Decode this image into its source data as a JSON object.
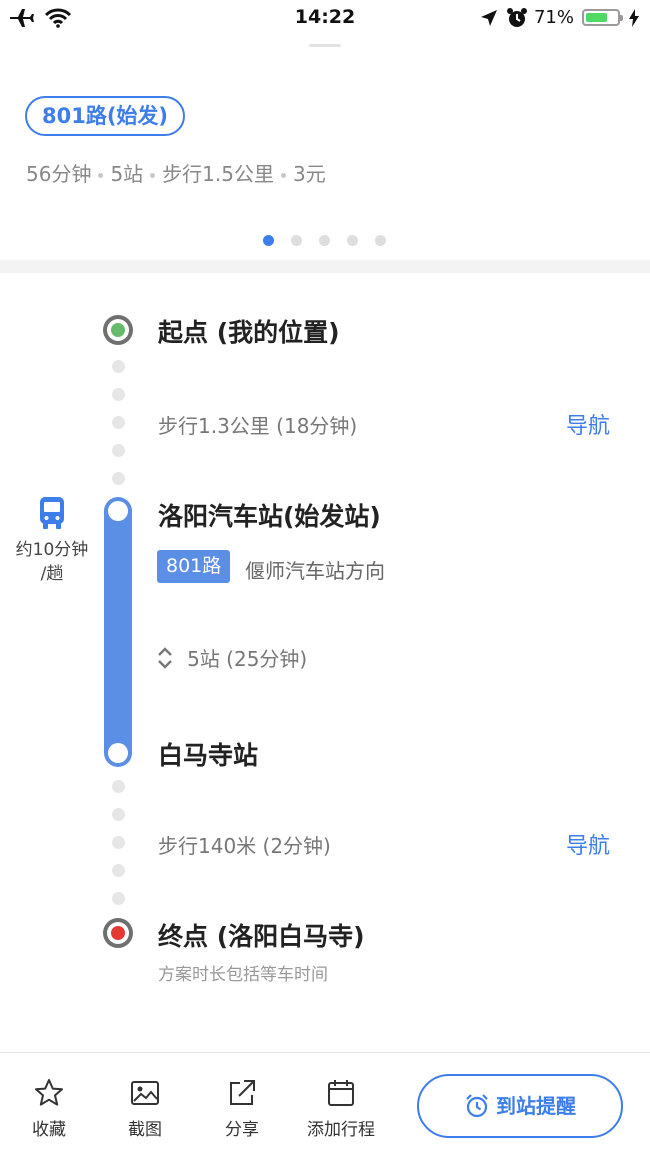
{
  "status_bar": {
    "time": "14:22",
    "battery_percent": "71%",
    "battery_level": 0.71
  },
  "route": {
    "pill": "801路(始发)",
    "summary": [
      "56分钟",
      "5站",
      "步行1.5公里",
      "3元"
    ],
    "pager": {
      "count": 5,
      "active": 1
    }
  },
  "steps": {
    "start_title": "起点 (我的位置)",
    "walk1": "步行1.3公里 (18分钟)",
    "walk1_nav": "导航",
    "board_title": "洛阳汽车站(始发站)",
    "line_badge": "801路",
    "direction": "偃师汽车站方向",
    "stops_info": "5站 (25分钟)",
    "alight_title": "白马寺站",
    "walk2": "步行140米 (2分钟)",
    "walk2_nav": "导航",
    "end_title": "终点 (洛阳白马寺)",
    "note": "方案时长包括等车时间",
    "bus_freq_line1": "约10分钟",
    "bus_freq_line2": "/趟"
  },
  "toolbar": {
    "favorite": "收藏",
    "screenshot": "截图",
    "share": "分享",
    "add_schedule": "添加行程",
    "arrival_reminder": "到站提醒"
  },
  "colors": {
    "accent": "#3d7eea",
    "bus_line": "#5b8fe6",
    "start_dot": "#4caf50",
    "end_dot": "#e53935"
  },
  "icons": [
    "airplane-icon",
    "wifi-icon",
    "location-arrow-icon",
    "alarm-icon",
    "battery-icon",
    "charging-icon",
    "bus-icon",
    "expand-icon",
    "star-icon",
    "image-icon",
    "share-icon",
    "calendar-icon",
    "alarm-clock-icon"
  ]
}
